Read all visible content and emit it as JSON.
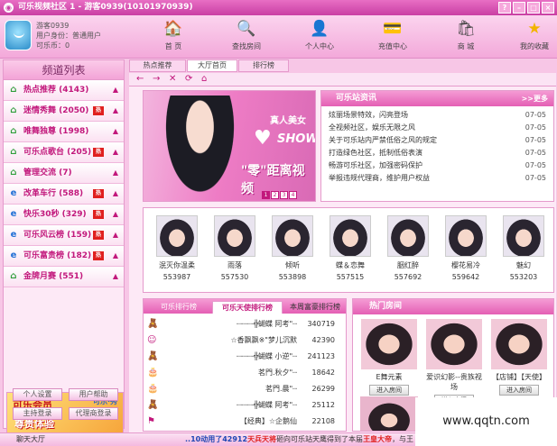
{
  "window": {
    "title": "可乐视频社区 1 - 游客0939(10101970939)",
    "buttons": [
      "?",
      "–",
      "□",
      "×"
    ]
  },
  "user": {
    "name": "游客0939",
    "identity": "用户身份：普通用户",
    "coins": "可乐币：0"
  },
  "nav": [
    {
      "label": "首 页",
      "icon": "home-icon",
      "glyph": "🏠"
    },
    {
      "label": "查找房间",
      "icon": "magnifier-icon",
      "glyph": "🔍"
    },
    {
      "label": "个人中心",
      "icon": "person-icon",
      "glyph": "👤"
    },
    {
      "label": "充值中心",
      "icon": "recharge-icon",
      "glyph": "💳"
    },
    {
      "label": "商 城",
      "icon": "shop-icon",
      "glyph": "🛍"
    },
    {
      "label": "我的收藏",
      "icon": "star-icon",
      "glyph": "★"
    }
  ],
  "sidebar": {
    "title": "频道列表",
    "channels": [
      {
        "label": "热点推荐 (4143)",
        "hot": false,
        "icon": "house-icon"
      },
      {
        "label": "迷情秀舞 (2050)",
        "hot": true,
        "icon": "house-icon"
      },
      {
        "label": "唯舞独尊 (1998)",
        "hot": false,
        "icon": "house-icon"
      },
      {
        "label": "可乐点歌台 (205)",
        "hot": true,
        "icon": "house-icon"
      },
      {
        "label": "管理交流 (7)",
        "hot": false,
        "icon": "house-icon"
      },
      {
        "label": "改革车行 (588)",
        "hot": true,
        "icon": "ie-icon"
      },
      {
        "label": "快乐30秒 (329)",
        "hot": true,
        "icon": "ie-icon"
      },
      {
        "label": "可乐风云榜 (159)",
        "hot": true,
        "icon": "ie-icon"
      },
      {
        "label": "可乐富贵榜 (182)",
        "hot": true,
        "icon": "ie-icon"
      },
      {
        "label": "金牌月赛 (551)",
        "hot": false,
        "icon": "house-icon"
      }
    ],
    "hot_badge": "热",
    "banner": {
      "line1": "可乐会员",
      "line2": "尊贵体验",
      "line3": "可乐·秀"
    },
    "buttons": [
      "个人设置",
      "用户帮助",
      "主持登录",
      "代理商登录"
    ]
  },
  "tabs": [
    "热点推荐 (4143)",
    "大厅首页",
    "排行榜"
  ],
  "toolbar": [
    "←",
    "→",
    "✕",
    "⟳",
    "⌂"
  ],
  "hero": {
    "line1": "真人美女",
    "line2": "SHOW",
    "line3": "\"零\"距离视频",
    "line4": "",
    "pages": [
      "1",
      "2",
      "3",
      "4"
    ]
  },
  "news": {
    "title": "可乐站资讯",
    "more": ">>更多",
    "items": [
      {
        "text": "炫丽场景特效，闪亮登场",
        "date": "07-05"
      },
      {
        "text": "全视频社区，娱乐无限之风",
        "date": "07-05"
      },
      {
        "text": "关于可乐站内严禁低俗之风的规定",
        "date": "07-05"
      },
      {
        "text": "打造绿色社区，抵制低俗表演",
        "date": "07-05"
      },
      {
        "text": "畅游可乐社区，加强密码保护",
        "date": "07-05"
      },
      {
        "text": "举报违规代理商，维护用户权益",
        "date": "07-05"
      }
    ]
  },
  "performers": [
    {
      "name": "泯灭你温柔",
      "id": "553987"
    },
    {
      "name": "雨落",
      "id": "557530"
    },
    {
      "name": "倾听",
      "id": "553898"
    },
    {
      "name": "蝶＆恋舞",
      "id": "557515"
    },
    {
      "name": "胭红醉",
      "id": "557692"
    },
    {
      "name": "樱花易冷",
      "id": "559642"
    },
    {
      "name": "魅幻",
      "id": "553203"
    }
  ],
  "ranking": {
    "tabs": [
      "可乐排行榜",
      "可乐天使排行榜",
      "本周富豪排行榜"
    ],
    "rows": [
      {
        "name": "┈┈┈┈╬蝴蝶 阿考\"┈",
        "value": "340719",
        "icon": "bear-icon"
      },
      {
        "name": "☆香飘飘※\"梦儿沉默",
        "value": "42390",
        "icon": "smiley-icon"
      },
      {
        "name": "┈┈┈┈╬蝴蝶 小逆\"┈",
        "value": "241123",
        "icon": "bear-icon"
      },
      {
        "name": "茗門.秋夕\"┈",
        "value": "18642",
        "icon": "cake-icon"
      },
      {
        "name": "茗門.晨\"┈",
        "value": "26299",
        "icon": "cake-icon"
      },
      {
        "name": "┈┈┈┈╬蝴蝶 阿考\"┈",
        "value": "25112",
        "icon": "bear-icon"
      },
      {
        "name": "【经典】☆企鹅仙",
        "value": "22108",
        "icon": "flag-icon"
      }
    ]
  },
  "hotrooms": {
    "title": "热门房间",
    "rooms": [
      {
        "name": "E舞元素",
        "btn": "进入房间"
      },
      {
        "name": "爱识幻影--贵族视场",
        "btn": "进入房间"
      },
      {
        "name": "【店铺】【天使】",
        "btn": "进入房间"
      }
    ]
  },
  "status": {
    "lobby": "聊天大厅",
    "ticker_a": "..10动用了",
    "ticker_num": "42912",
    "ticker_b": "天兵天将",
    "ticker_c": "砸向可乐站天鹰得到了本届",
    "ticker_d": "王皇大帝",
    "ticker_e": "，与王"
  },
  "watermark": "www.qqtn.com",
  "colors": {
    "accent": "#c2187c",
    "header": "#e45fb4",
    "hot": "#e0201f"
  }
}
